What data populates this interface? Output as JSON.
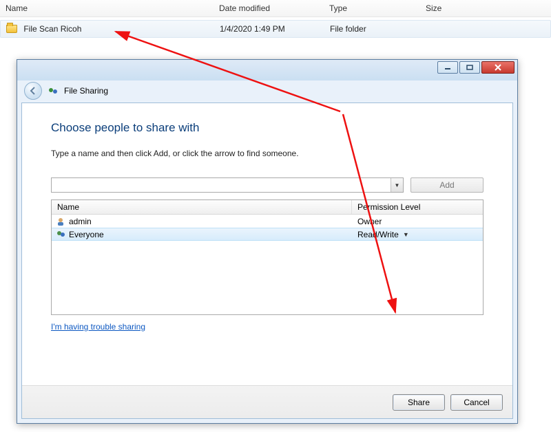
{
  "explorer": {
    "columns": {
      "name": "Name",
      "date": "Date modified",
      "type": "Type",
      "size": "Size"
    },
    "row": {
      "name": "File Scan Ricoh",
      "date": "1/4/2020 1:49 PM",
      "type": "File folder",
      "size": ""
    }
  },
  "dialog": {
    "header_label": "File Sharing",
    "title": "Choose people to share with",
    "subtitle": "Type a name and then click Add, or click the arrow to find someone.",
    "add_label": "Add",
    "combo_value": "",
    "list": {
      "col_name": "Name",
      "col_perm": "Permission Level",
      "rows": [
        {
          "name": "admin",
          "perm": "Owner",
          "dropdown": false,
          "selected": false
        },
        {
          "name": "Everyone",
          "perm": "Read/Write",
          "dropdown": true,
          "selected": true
        }
      ]
    },
    "trouble_link": "I'm having trouble sharing",
    "share_label": "Share",
    "cancel_label": "Cancel"
  }
}
